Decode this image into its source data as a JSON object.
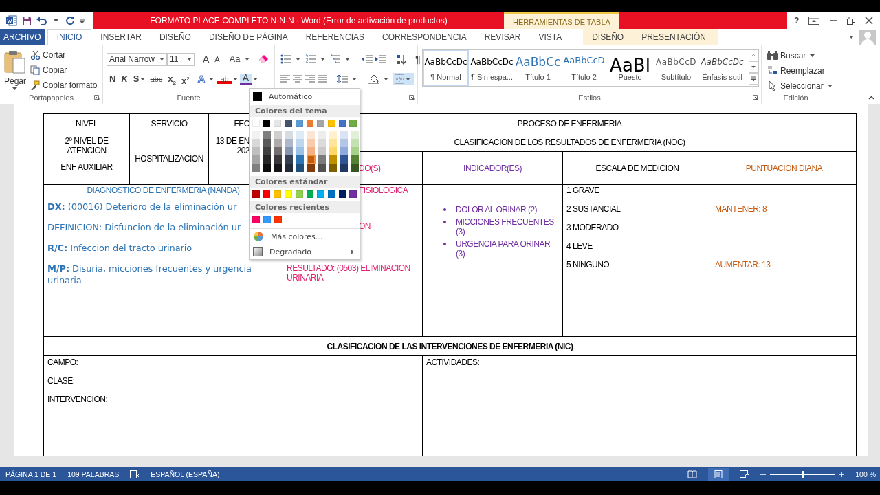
{
  "title_bar": {
    "title": "FORMATO PLACE COMPLETO N-N-N -  Word (Error de activación de productos)",
    "context_group": "HERRAMIENTAS DE TABLA",
    "help": "?"
  },
  "tabs": [
    {
      "label": "ARCHIVO",
      "kind": "file",
      "selected": false
    },
    {
      "label": "INICIO",
      "kind": "tab",
      "selected": true
    },
    {
      "label": "INSERTAR",
      "kind": "tab",
      "selected": false
    },
    {
      "label": "DISEÑO",
      "kind": "tab",
      "selected": false
    },
    {
      "label": "DISEÑO DE PÁGINA",
      "kind": "tab",
      "selected": false
    },
    {
      "label": "REFERENCIAS",
      "kind": "tab",
      "selected": false
    },
    {
      "label": "CORRESPONDENCIA",
      "kind": "tab",
      "selected": false
    },
    {
      "label": "REVISAR",
      "kind": "tab",
      "selected": false
    },
    {
      "label": "VISTA",
      "kind": "tab",
      "selected": false
    },
    {
      "label": "DISEÑO",
      "kind": "context",
      "selected": false
    },
    {
      "label": "PRESENTACIÓN",
      "kind": "context",
      "selected": false
    }
  ],
  "ribbon": {
    "clipboard": {
      "label": "Portapapeles",
      "paste": "Pegar",
      "actions": [
        "Cortar",
        "Copiar",
        "Copiar formato"
      ]
    },
    "font": {
      "label": "Fuente",
      "font_name": "Arial Narrow",
      "font_size": "11",
      "grow": "A",
      "shrink": "A",
      "change_case": "Aa",
      "bold": "N",
      "italic": "K",
      "underline": "S",
      "strike": "abc",
      "subscript": "x$_{2}$",
      "superscript": "x$^{2}$",
      "text_effects": "A",
      "highlight": "ab",
      "font_color": "A",
      "font_color_open": true
    },
    "paragraph": {
      "show_marks": "¶"
    },
    "styles": {
      "label": "Estilos",
      "items": [
        {
          "sample": "AaBbCcDc",
          "name": "¶ Normal",
          "kind": "normal",
          "selected": true
        },
        {
          "sample": "AaBbCcDc",
          "name": "¶ Sin espa...",
          "kind": "plain",
          "selected": false
        },
        {
          "sample": "AaBbCc",
          "name": "Título 1",
          "kind": "heading1",
          "selected": false
        },
        {
          "sample": "AaBbCcD",
          "name": "Título 2",
          "kind": "heading2",
          "selected": false
        },
        {
          "sample": "AaBl",
          "name": "Puesto",
          "kind": "title",
          "selected": false
        },
        {
          "sample": "AaBbCcD",
          "name": "Subtítulo",
          "kind": "subtitle",
          "selected": false
        },
        {
          "sample": "AaBbCcDc",
          "name": "Énfasis sutil",
          "kind": "emphasis",
          "selected": false
        }
      ]
    },
    "editing": {
      "label": "Edición",
      "actions": [
        {
          "label": "Buscar",
          "kind": "find"
        },
        {
          "label": "Reemplazar",
          "kind": "replace"
        },
        {
          "label": "Seleccionar",
          "kind": "select"
        }
      ]
    }
  },
  "color_menu": {
    "automatic": "Automático",
    "theme_header": "Colores del tema",
    "theme": [
      {
        "color": "#ffffff",
        "shades": [
          {
            "color": "#f2f2f2",
            "highlighted": false
          },
          {
            "color": "#d9d9d9",
            "highlighted": false
          },
          {
            "color": "#bfbfbf",
            "highlighted": false
          },
          {
            "color": "#a6a6a6",
            "highlighted": false
          },
          {
            "color": "#808080",
            "highlighted": false
          }
        ]
      },
      {
        "color": "#000000",
        "shades": [
          {
            "color": "#7f7f7f",
            "highlighted": false
          },
          {
            "color": "#595959",
            "highlighted": false
          },
          {
            "color": "#404040",
            "highlighted": false
          },
          {
            "color": "#262626",
            "highlighted": false
          },
          {
            "color": "#0d0d0d",
            "highlighted": false
          }
        ]
      },
      {
        "color": "#e7e6e6",
        "shades": [
          {
            "color": "#d0cece",
            "highlighted": false
          },
          {
            "color": "#aeabab",
            "highlighted": false
          },
          {
            "color": "#757070",
            "highlighted": false
          },
          {
            "color": "#3a3838",
            "highlighted": false
          },
          {
            "color": "#171616",
            "highlighted": false
          }
        ]
      },
      {
        "color": "#44546a",
        "shades": [
          {
            "color": "#d6dce4",
            "highlighted": false
          },
          {
            "color": "#adb9ca",
            "highlighted": false
          },
          {
            "color": "#8496b0",
            "highlighted": false
          },
          {
            "color": "#333f4f",
            "highlighted": false
          },
          {
            "color": "#222a35",
            "highlighted": false
          }
        ]
      },
      {
        "color": "#5b9bd5",
        "shades": [
          {
            "color": "#deebf6",
            "highlighted": false
          },
          {
            "color": "#bdd7ee",
            "highlighted": false
          },
          {
            "color": "#9cc3e5",
            "highlighted": false
          },
          {
            "color": "#2e75b5",
            "highlighted": false
          },
          {
            "color": "#1e4e79",
            "highlighted": false
          }
        ]
      },
      {
        "color": "#ed7d31",
        "shades": [
          {
            "color": "#fbe5d5",
            "highlighted": false
          },
          {
            "color": "#f7cbac",
            "highlighted": false
          },
          {
            "color": "#f4b183",
            "highlighted": false
          },
          {
            "color": "#c55a11",
            "highlighted": true
          },
          {
            "color": "#833c0b",
            "highlighted": false
          }
        ]
      },
      {
        "color": "#a5a5a5",
        "shades": [
          {
            "color": "#ededed",
            "highlighted": false
          },
          {
            "color": "#dbdbdb",
            "highlighted": false
          },
          {
            "color": "#c9c9c9",
            "highlighted": false
          },
          {
            "color": "#7b7b7b",
            "highlighted": false
          },
          {
            "color": "#525252",
            "highlighted": false
          }
        ]
      },
      {
        "color": "#ffc000",
        "shades": [
          {
            "color": "#fff2cc",
            "highlighted": false
          },
          {
            "color": "#fee599",
            "highlighted": false
          },
          {
            "color": "#ffd965",
            "highlighted": false
          },
          {
            "color": "#bf9000",
            "highlighted": false
          },
          {
            "color": "#7f6000",
            "highlighted": false
          }
        ]
      },
      {
        "color": "#4472c4",
        "shades": [
          {
            "color": "#dae3f3",
            "highlighted": false
          },
          {
            "color": "#b4c6e7",
            "highlighted": false
          },
          {
            "color": "#8eaadb",
            "highlighted": false
          },
          {
            "color": "#2f5496",
            "highlighted": false
          },
          {
            "color": "#1f3864",
            "highlighted": false
          }
        ]
      },
      {
        "color": "#70ad47",
        "shades": [
          {
            "color": "#e2efd9",
            "highlighted": false
          },
          {
            "color": "#c5e0b3",
            "highlighted": false
          },
          {
            "color": "#a8d08d",
            "highlighted": false
          },
          {
            "color": "#538135",
            "highlighted": false
          },
          {
            "color": "#375623",
            "highlighted": false
          }
        ]
      }
    ],
    "standard_header": "Colores estándar",
    "standard": [
      {
        "color": "#c00000"
      },
      {
        "color": "#ff0000"
      },
      {
        "color": "#ffc000"
      },
      {
        "color": "#ffff00"
      },
      {
        "color": "#92d050"
      },
      {
        "color": "#00b050"
      },
      {
        "color": "#00b0f0"
      },
      {
        "color": "#0070c0"
      },
      {
        "color": "#002060"
      },
      {
        "color": "#7030a0"
      }
    ],
    "recent_header": "Colores recientes",
    "recent": [
      {
        "color": "#ff0066"
      },
      {
        "color": "#3399ff"
      },
      {
        "color": "#ff3300"
      }
    ],
    "more": "Más colores...",
    "gradient": "Degradado"
  },
  "document": {
    "nivel_header": "NIVEL",
    "servicio_header": "SERVICIO",
    "fecha_header": "FEC",
    "proceso_title": "PROCESO DE ENFERMERIA",
    "nivel": [
      "2º NIVEL DE ATENCION",
      "ENF AUXILIAR"
    ],
    "servicio": "HOSPITALIZACION",
    "fecha": [
      "13 DE EN",
      "202"
    ],
    "noc_title": "CLASIFICACION DE LOS RESULTADOS DE ENFERMERIA (NOC)",
    "noc_headers": [
      {
        "text": "DO(S)",
        "color": "#e0206e"
      },
      {
        "text": "INDICADOR(ES)",
        "color": "#7030a0"
      },
      {
        "text": "ESCALA DE MEDICION",
        "color": "#000000"
      },
      {
        "text": "PUNTUACION DIANA",
        "color": "#c55a11"
      }
    ],
    "diagnosis": {
      "title": "DIAGNOSTICO DE ENFERMERIA (NANDA)",
      "lines": [
        "**DX:** (00016) Deterioro de la eliminación ur",
        "DEFINICION: Disfuncion de la eliminación ur",
        "**R/C:** Infeccion del tracto urinario",
        "**M/P:** Disuria, micciones frecuentes y urgencia urinaria"
      ]
    },
    "result": {
      "fragments": [
        "FISIOLOGICA",
        "ON"
      ],
      "title": "RESULTADO: (0503) ELIMINACION URINARIA"
    },
    "indicators": [
      "DOLOR AL ORINAR (2)",
      "MICCIONES FRECUENTES (3)",
      "URGENCIA PARA ORINAR (3)"
    ],
    "scale": [
      "1 GRAVE",
      "2 SUSTANCIAL",
      "3 MODERADO",
      "4 LEVE",
      "5 NINGUNO"
    ],
    "targets": [
      "MANTENER: 8",
      "AUMENTAR: 13"
    ],
    "nic_title": "CLASIFICACION DE LAS INTERVENCIONES DE ENFERMERIA (NIC)",
    "nic_fields": [
      "CAMPO:",
      "CLASE:",
      "INTERVENCION:"
    ],
    "activities": "ACTIVIDADES:"
  },
  "status_bar": {
    "page": "PÁGINA 1 DE 1",
    "words": "109 PALABRAS",
    "language": "ESPAÑOL (ESPAÑA)",
    "zoom": {
      "level": 0.5,
      "reading": "100 %"
    }
  }
}
